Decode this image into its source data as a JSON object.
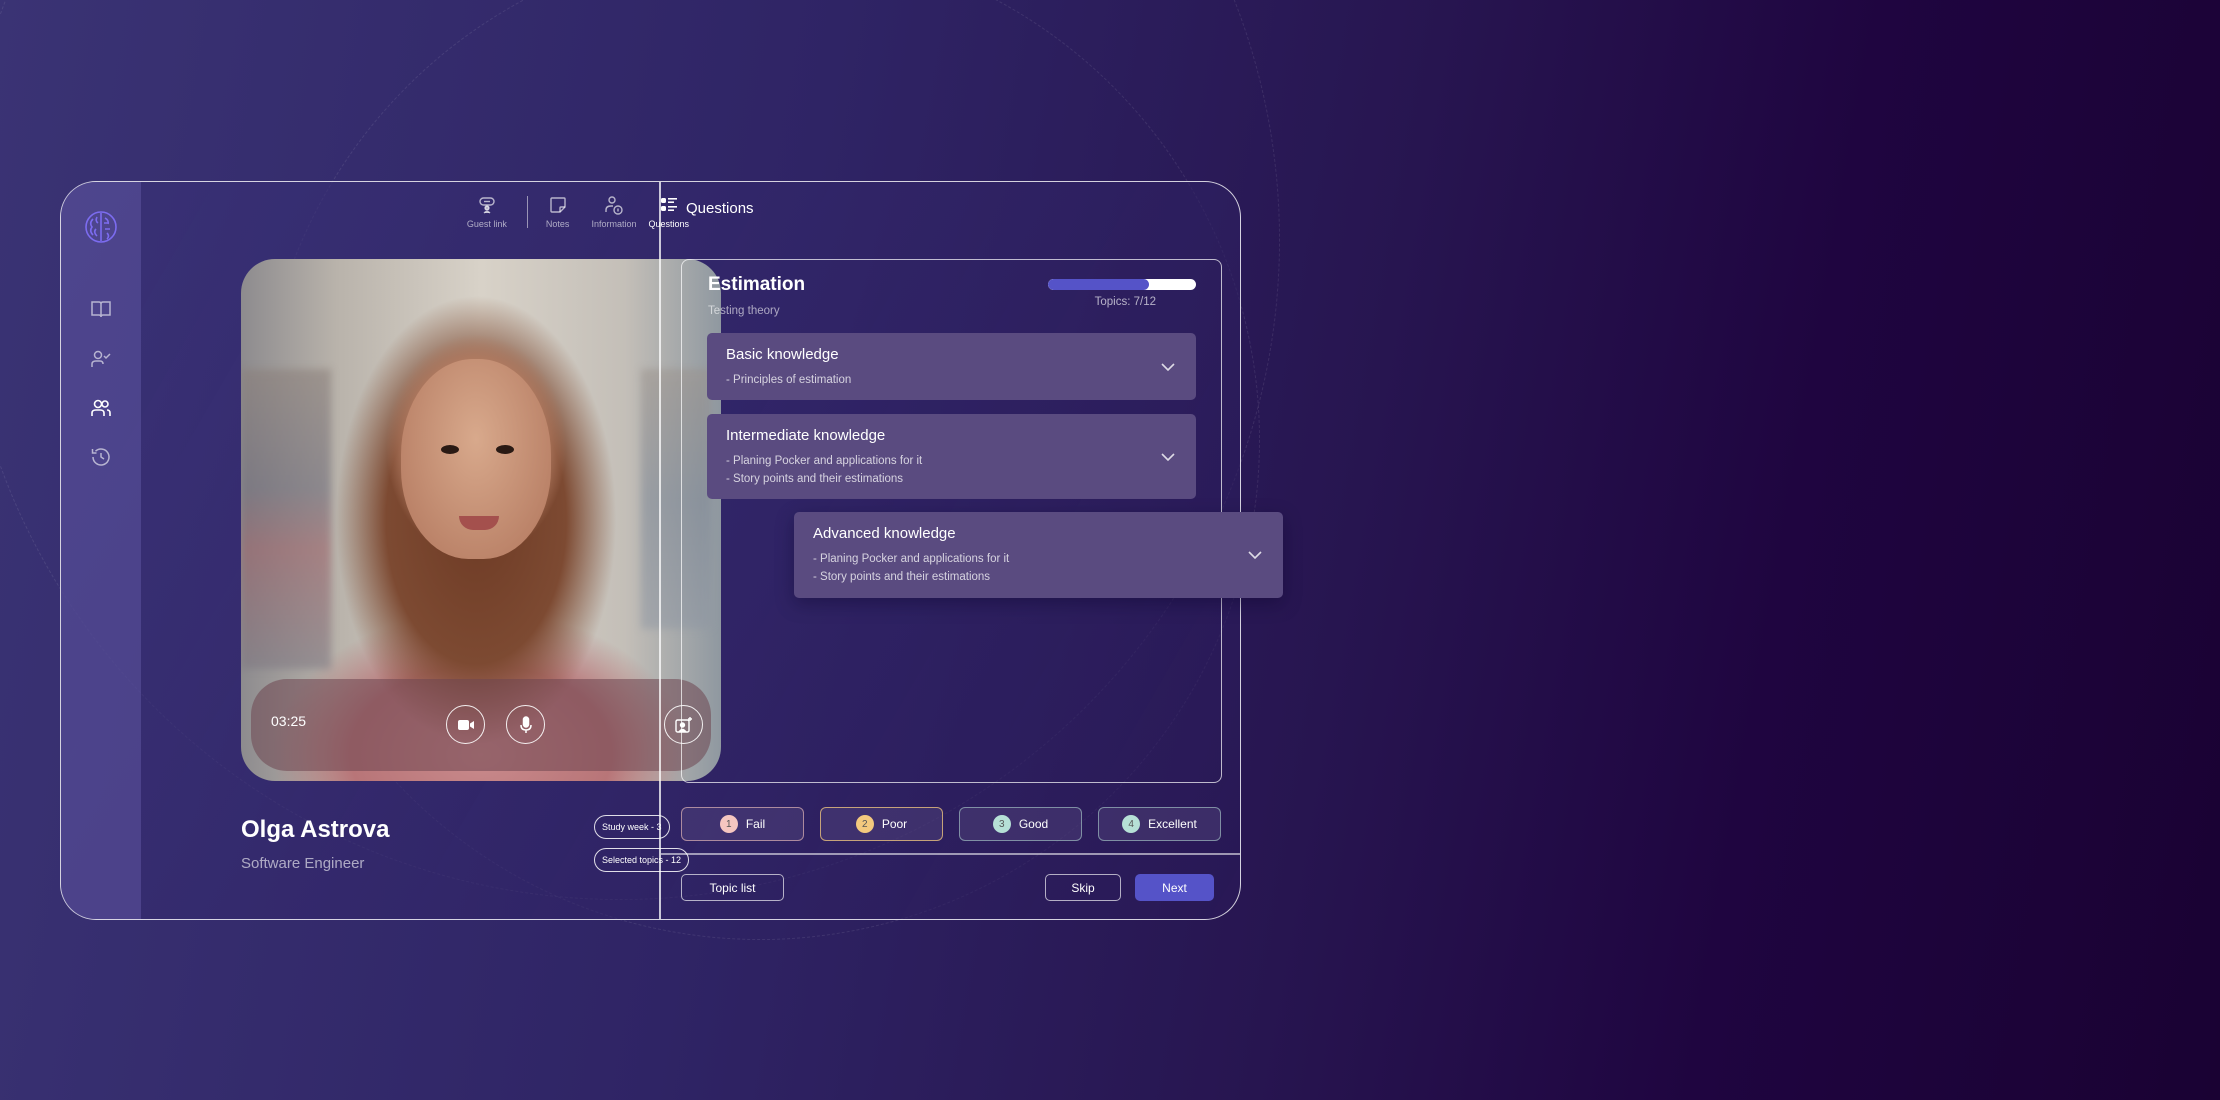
{
  "colors": {
    "accent": "#5553c8",
    "card_bg": "#5a4b80",
    "fail": "#f5c6c0",
    "poor": "#f3c97e",
    "good": "#b6e0d6",
    "excellent": "#b6e0d6"
  },
  "sidebar": {
    "logo_icon": "brain-icon",
    "items": [
      {
        "name": "library",
        "icon": "book-open-icon"
      },
      {
        "name": "candidates-checked",
        "icon": "user-check-icon"
      },
      {
        "name": "interviews",
        "icon": "users-icon",
        "active": true
      },
      {
        "name": "history",
        "icon": "history-icon"
      }
    ]
  },
  "topnav": {
    "tabs": [
      {
        "label": "Guest link",
        "icon": "link-user-icon"
      },
      {
        "label": "Notes",
        "icon": "note-icon"
      },
      {
        "label": "Information",
        "icon": "user-info-icon"
      },
      {
        "label": "Questions",
        "icon": "list-icon",
        "active": true
      }
    ]
  },
  "video": {
    "timer": "03:25",
    "controls": [
      {
        "name": "camera",
        "icon": "video-camera-icon"
      },
      {
        "name": "microphone",
        "icon": "microphone-icon"
      },
      {
        "name": "background-effects",
        "icon": "image-sparkle-icon"
      }
    ]
  },
  "candidate": {
    "name": "Olga Astrova",
    "role": "Software Engineer",
    "chips": [
      "Study week - 3",
      "Selected topics - 12"
    ]
  },
  "questions": {
    "section_title": "Questions",
    "topic": {
      "title": "Estimation",
      "subtitle": "Testing theory",
      "progress_label": "Topics: 7/12",
      "progress_fraction": 0.68
    },
    "levels": [
      {
        "title": "Basic knowledge",
        "items": [
          "- Principles of estimation"
        ]
      },
      {
        "title": "Intermediate knowledge",
        "items": [
          "- Planing Pocker and applications for it",
          "- Story points and their estimations"
        ]
      },
      {
        "title": "Advanced knowledge",
        "items": [
          "- Planing Pocker and applications for it",
          "- Story points and their estimations"
        ]
      }
    ],
    "ratings": [
      {
        "num": "1",
        "label": "Fail"
      },
      {
        "num": "2",
        "label": "Poor"
      },
      {
        "num": "3",
        "label": "Good"
      },
      {
        "num": "4",
        "label": "Excellent"
      }
    ]
  },
  "footer": {
    "topic_list_label": "Topic list",
    "skip_label": "Skip",
    "next_label": "Next"
  }
}
